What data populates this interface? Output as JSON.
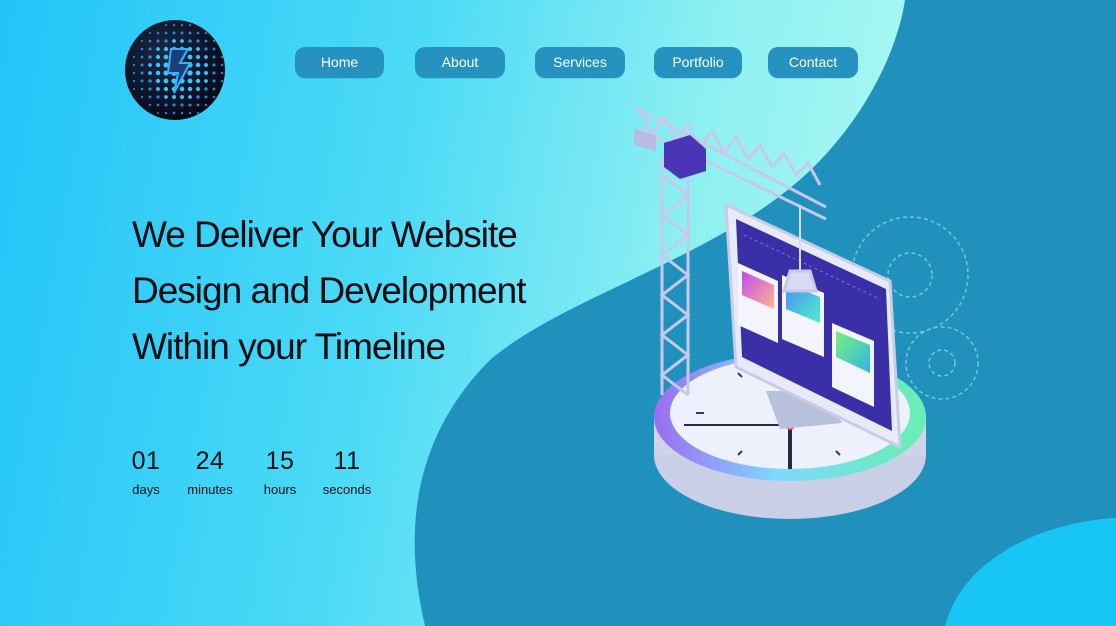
{
  "nav": {
    "items": [
      {
        "label": "Home"
      },
      {
        "label": "About"
      },
      {
        "label": "Services"
      },
      {
        "label": "Portfolio"
      },
      {
        "label": "Contact"
      }
    ]
  },
  "hero": {
    "lines": [
      "We Deliver Your Website",
      "Design and Development",
      "Within your Timeline"
    ]
  },
  "countdown": {
    "days": {
      "value": "01",
      "label": "days"
    },
    "minutes": {
      "value": "24",
      "label": "minutes"
    },
    "hours": {
      "value": "15",
      "label": "hours"
    },
    "seconds": {
      "value": "11",
      "label": "seconds"
    }
  },
  "colors": {
    "nav_button": "#2592bf",
    "dark_wave": "#2090bc",
    "light_gradient_start": "#22c4f8",
    "light_gradient_end": "#b6fbf1",
    "corner_blob": "#18c6f6",
    "monitor_screen": "#3b2fa8"
  },
  "icons": {
    "logo": "dotted-sphere-logo-icon",
    "gears": "gear-outline-icon",
    "crane": "construction-crane-icon",
    "clock": "clock-platform-icon"
  }
}
